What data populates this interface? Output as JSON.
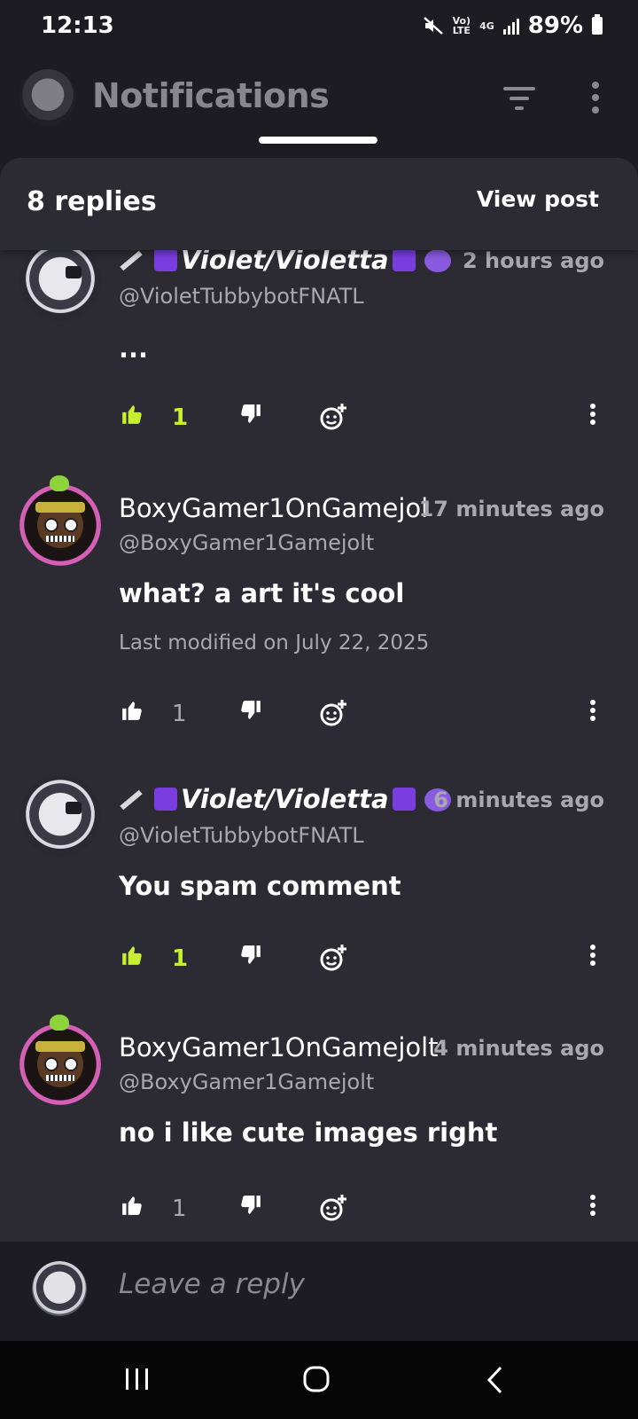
{
  "status_bar": {
    "time": "12:13",
    "network_top": "Vo)",
    "network_bottom": "LTE",
    "network_gen": "4G",
    "battery": "89%"
  },
  "header": {
    "title": "Notifications",
    "icons": [
      "app-logo",
      "filter-icon",
      "more-vert-icon"
    ]
  },
  "sheet": {
    "replies_label": "8 replies",
    "view_post_label": "View post"
  },
  "comments": [
    {
      "username": "Violet/Violetta",
      "handle": "@VioletTubbybotFNATL",
      "time": "2 hours ago",
      "body": "...",
      "likes": "1",
      "liked": true
    },
    {
      "username": "BoxyGamer1OnGamejolt",
      "handle": "@BoxyGamer1Gamejolt",
      "time": "17 minutes ago",
      "body": "what? a art it's cool",
      "modified": "Last modified on July 22, 2025",
      "likes": "1",
      "liked": false
    },
    {
      "username": "Violet/Violetta",
      "handle": "@VioletTubbybotFNATL",
      "time": "6 minutes ago",
      "body": "You spam comment",
      "likes": "1",
      "liked": true
    },
    {
      "username": "BoxyGamer1OnGamejolt",
      "handle": "@BoxyGamer1Gamejolt",
      "time": "4 minutes ago",
      "body": "no i like cute images right",
      "likes": "1",
      "liked": false
    }
  ],
  "reply_bar": {
    "placeholder": "Leave a reply"
  },
  "colors": {
    "background": "#1d1c22",
    "sheet": "#2c2b33",
    "liked_accent": "#c7ef2c",
    "muted_text": "#a9a8ae"
  }
}
